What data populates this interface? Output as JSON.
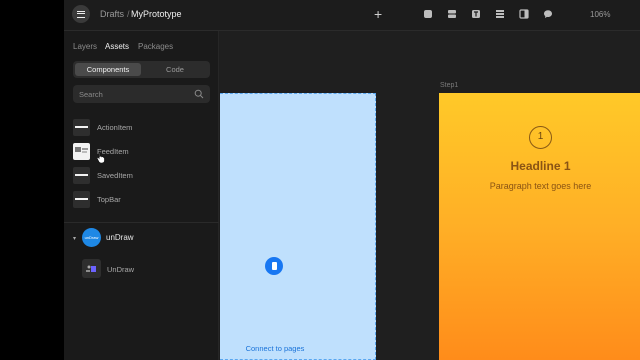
{
  "header": {
    "breadcrumb_drafts": "Drafts",
    "breadcrumb_sep": "/",
    "breadcrumb_current": "MyPrototype",
    "add_symbol": "+",
    "zoom": "106%",
    "tools": [
      "rectangle-tool-icon",
      "stack-tool-icon",
      "text-tool-icon",
      "list-tool-icon",
      "layout-tool-icon",
      "comment-tool-icon"
    ]
  },
  "sidebar": {
    "tabs": [
      {
        "label": "Layers",
        "active": false
      },
      {
        "label": "Assets",
        "active": true
      },
      {
        "label": "Packages",
        "active": false
      }
    ],
    "segment": [
      {
        "label": "Components",
        "active": true
      },
      {
        "label": "Code",
        "active": false
      }
    ],
    "search_placeholder": "Search",
    "components": [
      {
        "label": "ActionItem"
      },
      {
        "label": "FeedItem"
      },
      {
        "label": "SavedItem"
      },
      {
        "label": "TopBar"
      }
    ],
    "library": {
      "badge": "unDraw",
      "name": "unDraw",
      "items": [
        {
          "label": "UnDraw"
        }
      ]
    }
  },
  "canvas": {
    "connect_label": "Connect to pages",
    "frame_label": "Step1",
    "step_number": "1",
    "headline": "Headline 1",
    "paragraph": "Paragraph text goes here"
  },
  "colors": {
    "accent": "#1877f2",
    "frame_blue": "#bfe0fd",
    "frame_orange_top": "#ffc928",
    "frame_orange_bottom": "#ff8c1a"
  }
}
